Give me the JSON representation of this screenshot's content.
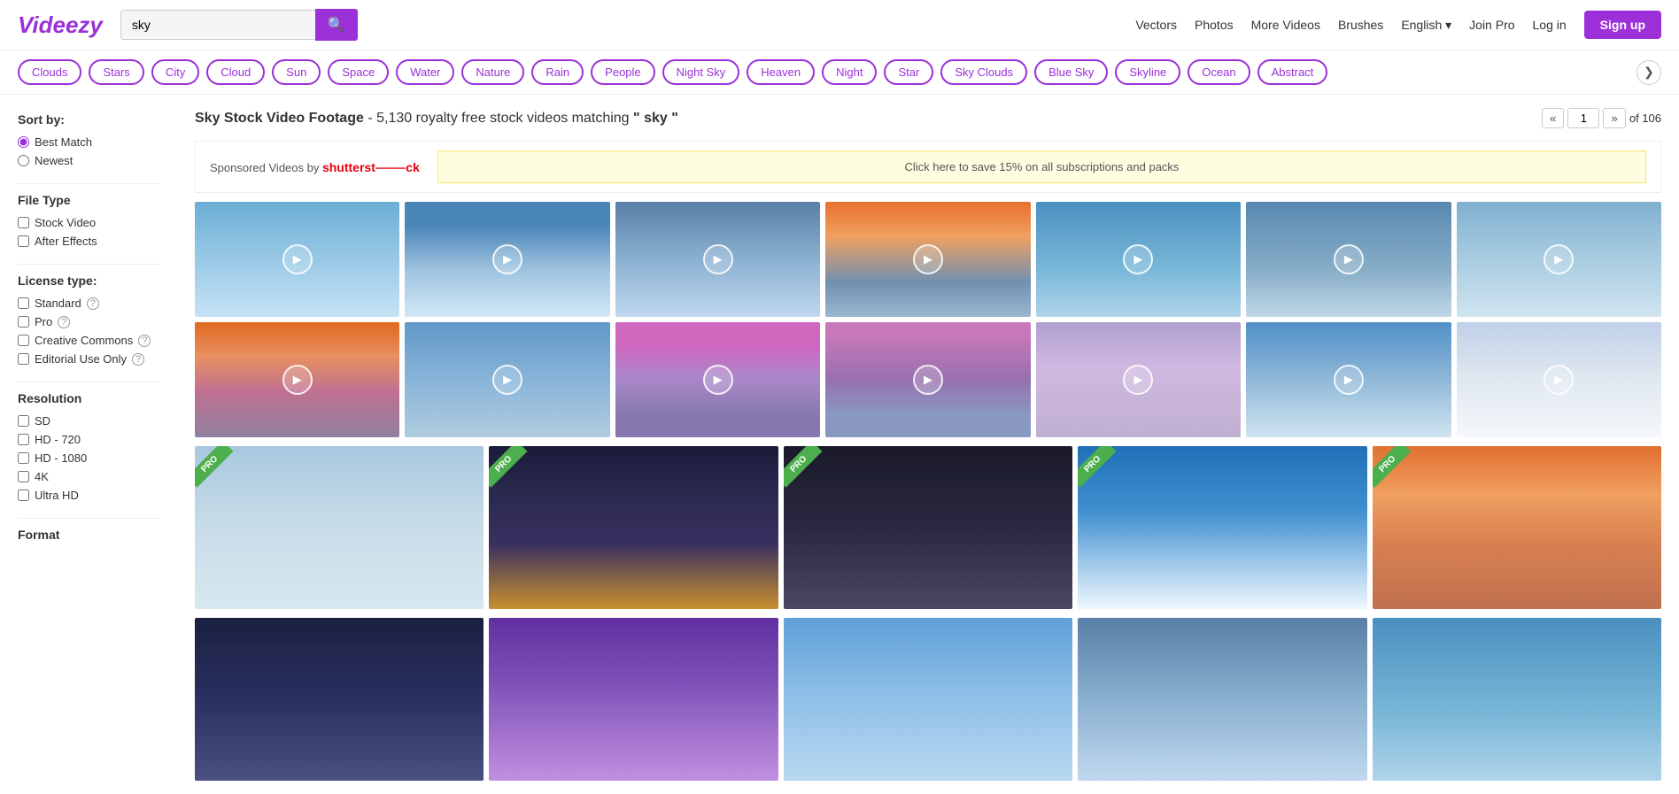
{
  "header": {
    "logo": "Videezy",
    "search_value": "sky",
    "search_placeholder": "sky",
    "nav": {
      "vectors": "Vectors",
      "photos": "Photos",
      "more_videos": "More Videos",
      "brushes": "Brushes",
      "language": "English",
      "join_pro": "Join Pro",
      "log_in": "Log in",
      "signup": "Sign up"
    }
  },
  "tags": [
    "Clouds",
    "Stars",
    "City",
    "Cloud",
    "Sun",
    "Space",
    "Water",
    "Nature",
    "Rain",
    "People",
    "Night Sky",
    "Heaven",
    "Night",
    "Star",
    "Sky Clouds",
    "Blue Sky",
    "Skyline",
    "Ocean",
    "Abstract"
  ],
  "sidebar": {
    "sort_by_label": "Sort by:",
    "sort_options": [
      {
        "label": "Best Match",
        "value": "best_match",
        "checked": true
      },
      {
        "label": "Newest",
        "value": "newest",
        "checked": false
      }
    ],
    "file_type_label": "File Type",
    "file_types": [
      {
        "label": "Stock Video",
        "checked": false
      },
      {
        "label": "After Effects",
        "checked": false
      }
    ],
    "license_label": "License type:",
    "licenses": [
      {
        "label": "Standard",
        "has_help": true,
        "checked": false
      },
      {
        "label": "Pro",
        "has_help": true,
        "checked": false
      },
      {
        "label": "Creative Commons",
        "has_help": true,
        "checked": false
      },
      {
        "label": "Editorial Use Only",
        "has_help": true,
        "checked": false
      }
    ],
    "resolution_label": "Resolution",
    "resolutions": [
      {
        "label": "SD",
        "checked": false
      },
      {
        "label": "HD - 720",
        "checked": false
      },
      {
        "label": "HD - 1080",
        "checked": false
      },
      {
        "label": "4K",
        "checked": false
      },
      {
        "label": "Ultra HD",
        "checked": false
      }
    ],
    "format_label": "Format"
  },
  "content": {
    "title": "Sky Stock Video Footage",
    "subtitle": "- 5,130 royalty free stock videos matching",
    "query": "sky",
    "current_page": "1",
    "total_pages": "of 106",
    "sponsored_text": "Sponsored Videos by",
    "shutterstock": "shutterstock",
    "promo_text": "Click here to save 15% on all subscriptions and packs"
  }
}
